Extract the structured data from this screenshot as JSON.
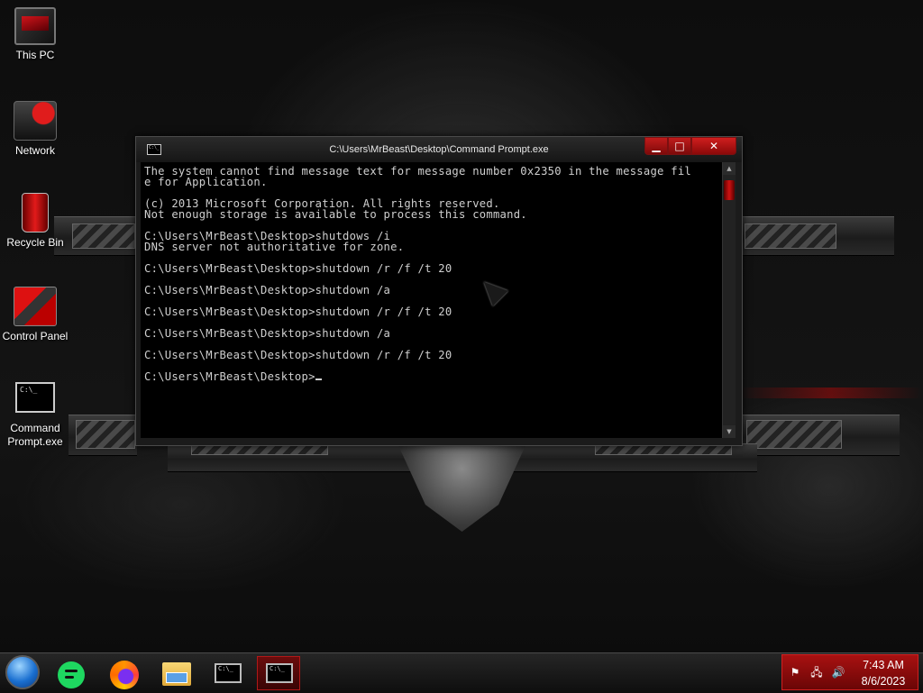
{
  "desktop": {
    "icons": [
      {
        "label": "This PC"
      },
      {
        "label": "Network"
      },
      {
        "label": "Recycle Bin"
      },
      {
        "label": "Control Panel"
      },
      {
        "label": "Command Prompt.exe"
      }
    ]
  },
  "window": {
    "title": "C:\\Users\\MrBeast\\Desktop\\Command Prompt.exe",
    "icon_glyph": "C:\\_",
    "controls": {
      "minimize": "▁",
      "maximize": "□",
      "close": "✕"
    },
    "console_lines": [
      "The system cannot find message text for message number 0x2350 in the message fil",
      "e for Application.",
      "",
      "(c) 2013 Microsoft Corporation. All rights reserved.",
      "Not enough storage is available to process this command.",
      "",
      "C:\\Users\\MrBeast\\Desktop>shutdows /i",
      "DNS server not authoritative for zone.",
      "",
      "C:\\Users\\MrBeast\\Desktop>shutdown /r /f /t 20",
      "",
      "C:\\Users\\MrBeast\\Desktop>shutdown /a",
      "",
      "C:\\Users\\MrBeast\\Desktop>shutdown /r /f /t 20",
      "",
      "C:\\Users\\MrBeast\\Desktop>shutdown /a",
      "",
      "C:\\Users\\MrBeast\\Desktop>shutdown /r /f /t 20",
      ""
    ],
    "prompt": "C:\\Users\\MrBeast\\Desktop>"
  },
  "taskbar": {
    "items": [
      {
        "icon": "start-orb-icon"
      },
      {
        "icon": "spotify-icon"
      },
      {
        "icon": "firefox-icon"
      },
      {
        "icon": "file-explorer-icon"
      },
      {
        "icon": "command-prompt-icon",
        "glyph": "C:\\_"
      },
      {
        "icon": "command-prompt-icon",
        "glyph": "C:\\_",
        "active": true
      }
    ],
    "tray": {
      "icons": [
        "action-center-flag-icon",
        "network-icon",
        "volume-icon"
      ],
      "time": "7:43 AM",
      "date": "8/6/2023"
    }
  },
  "colors": {
    "accent": "#b01818",
    "console_text": "#cfcfcf",
    "console_bg": "#000000"
  }
}
